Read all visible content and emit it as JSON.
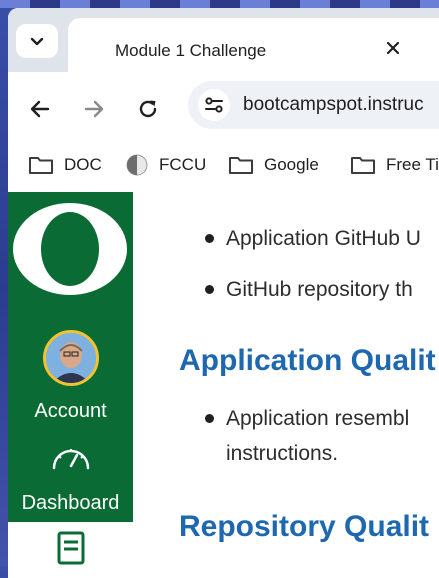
{
  "tabs": {
    "active_title": "Module 1 Challenge"
  },
  "toolbar": {
    "url": "bootcampspot.instruc"
  },
  "bookmarks": [
    {
      "label": "DOC",
      "icon": "folder-icon"
    },
    {
      "label": "FCCU",
      "icon": "site-favicon"
    },
    {
      "label": "Google",
      "icon": "folder-icon"
    },
    {
      "label": "Free Ti",
      "icon": "folder-icon"
    }
  ],
  "sidebar": {
    "logo_letter": "O",
    "account_label": "Account",
    "dashboard_label": "Dashboard",
    "brand_color": "#0b6b34"
  },
  "content": {
    "bullets_top": [
      "Application GitHub U",
      "GitHub repository th"
    ],
    "heading1": "Application Qualit",
    "bullets_mid_line1": "Application resembl",
    "bullets_mid_line2": "instructions.",
    "heading2": "Repository Qualit",
    "heading_color": "#1e68b0"
  }
}
